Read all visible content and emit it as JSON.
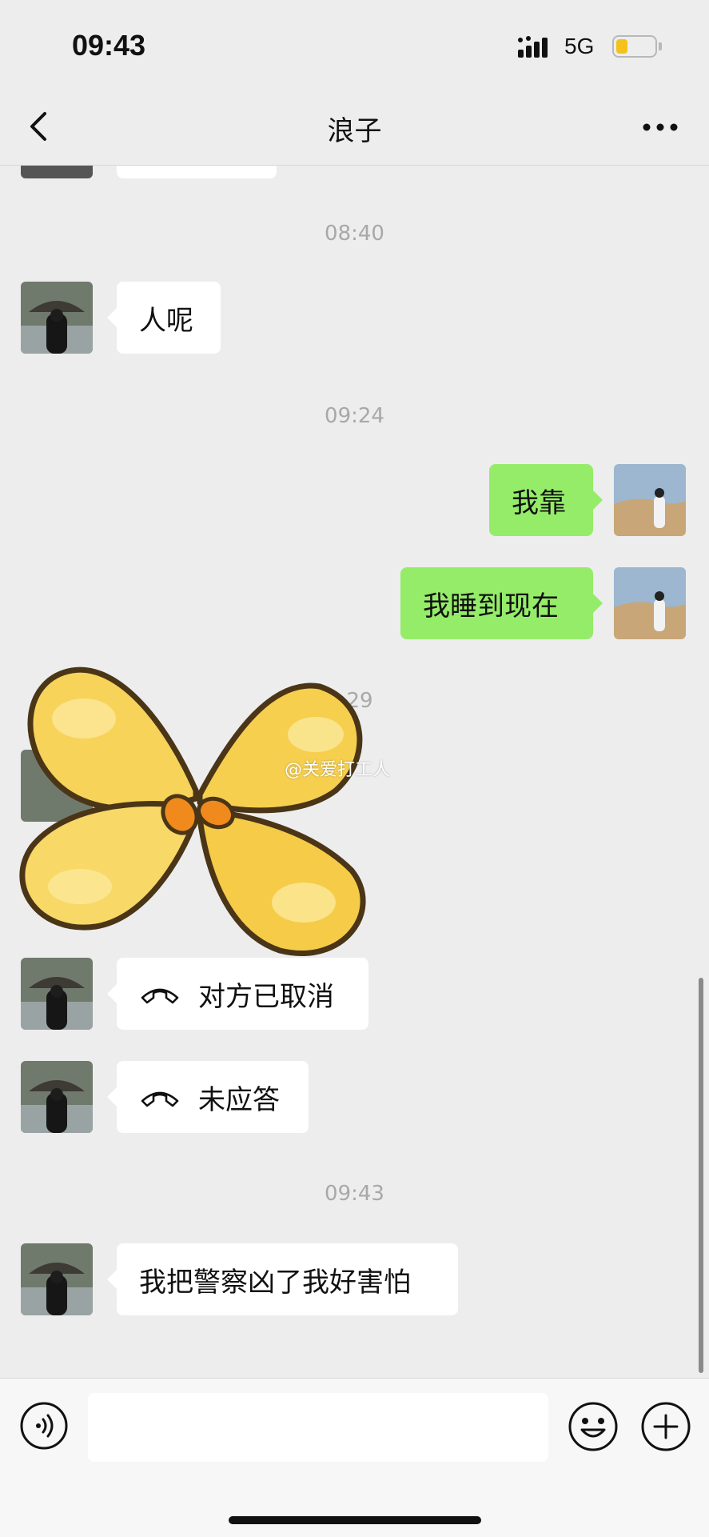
{
  "status_bar": {
    "time": "09:43",
    "network": "5G",
    "battery_level": 0.25
  },
  "header": {
    "title": "浪子",
    "back_icon": "chevron-left-icon",
    "more_icon": "more-icon"
  },
  "timestamps": [
    "08:40",
    "09:24",
    "29",
    "09:43"
  ],
  "messages": [
    {
      "side": "left",
      "text": "人呢"
    },
    {
      "side": "right",
      "text": "我靠"
    },
    {
      "side": "right",
      "text": "我睡到现在"
    },
    {
      "side": "left",
      "type": "voice-call",
      "text": "对方已取消"
    },
    {
      "side": "left",
      "type": "voice-call",
      "text": "未应答"
    },
    {
      "side": "left",
      "text": "我把警察凶了我好害怕"
    }
  ],
  "overlay": {
    "sticker": "yellow-flower-sticker",
    "watermark": "@关爱打工人"
  },
  "input_bar": {
    "voice_icon": "voice-icon",
    "emoji_icon": "emoji-icon",
    "plus_icon": "plus-icon"
  },
  "colors": {
    "background": "#ededed",
    "sent_bubble": "#95ec69",
    "received_bubble": "#ffffff",
    "timestamp": "#a8a8a8"
  }
}
